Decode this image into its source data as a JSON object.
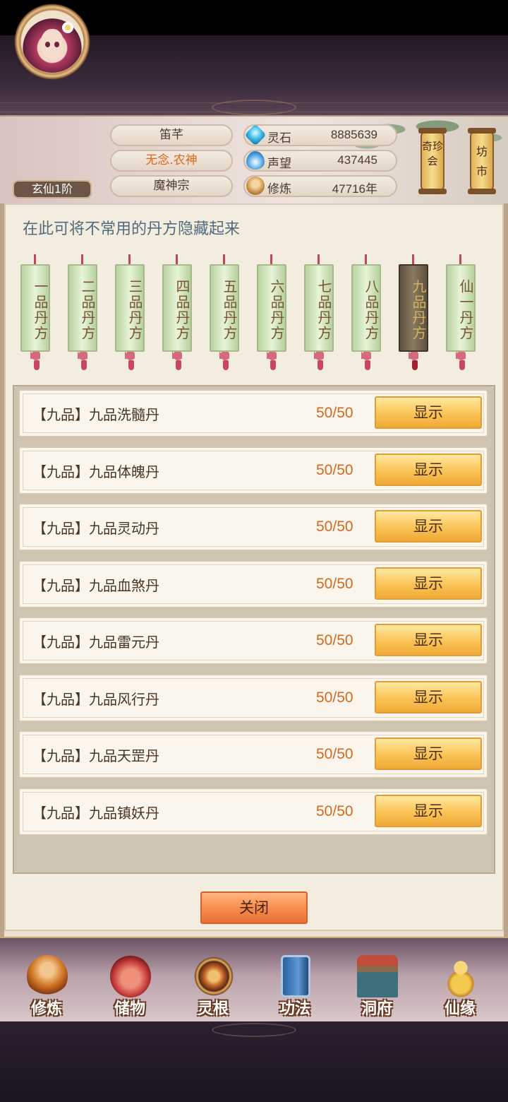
{
  "player": {
    "name": "笛芊",
    "title": "无念.农神",
    "sect": "魔神宗",
    "rank": "玄仙1阶"
  },
  "resources": [
    {
      "icon": "spirit-stone-icon",
      "label": "灵石",
      "value": "8885639"
    },
    {
      "icon": "fame-drop-icon",
      "label": "声望",
      "value": "437445"
    },
    {
      "icon": "cultivation-icon",
      "label": "修炼",
      "value": "47716年"
    }
  ],
  "lanterns": [
    {
      "label": "奇珍会"
    },
    {
      "label": "坊市"
    }
  ],
  "hint": "在此可将不常用的丹方隐藏起来",
  "tabs": [
    {
      "label": "一品丹方"
    },
    {
      "label": "二品丹方"
    },
    {
      "label": "三品丹方"
    },
    {
      "label": "四品丹方"
    },
    {
      "label": "五品丹方"
    },
    {
      "label": "六品丹方"
    },
    {
      "label": "七品丹方"
    },
    {
      "label": "八品丹方"
    },
    {
      "label": "九品丹方",
      "active": true
    },
    {
      "label": "仙一丹方"
    }
  ],
  "recipes": [
    {
      "name": "【九品】九品洗髓丹",
      "count": "50/50",
      "action": "显示"
    },
    {
      "name": "【九品】九品体魄丹",
      "count": "50/50",
      "action": "显示"
    },
    {
      "name": "【九品】九品灵动丹",
      "count": "50/50",
      "action": "显示"
    },
    {
      "name": "【九品】九品血煞丹",
      "count": "50/50",
      "action": "显示"
    },
    {
      "name": "【九品】九品雷元丹",
      "count": "50/50",
      "action": "显示"
    },
    {
      "name": "【九品】九品风行丹",
      "count": "50/50",
      "action": "显示"
    },
    {
      "name": "【九品】九品天罡丹",
      "count": "50/50",
      "action": "显示"
    },
    {
      "name": "【九品】九品镇妖丹",
      "count": "50/50",
      "action": "显示"
    }
  ],
  "close_label": "关闭",
  "nav": [
    {
      "label": "修炼",
      "icon": "monk-icon"
    },
    {
      "label": "储物",
      "icon": "bag-icon"
    },
    {
      "label": "灵根",
      "icon": "spirit-root-icon"
    },
    {
      "label": "功法",
      "icon": "book-icon"
    },
    {
      "label": "洞府",
      "icon": "cave-house-icon"
    },
    {
      "label": "仙缘",
      "icon": "gourd-icon"
    }
  ],
  "colors": {
    "accent_orange": "#d26a1c",
    "button_gold": "#fbc65b",
    "close_orange": "#f6894a",
    "hint_blue": "#516b7d"
  }
}
